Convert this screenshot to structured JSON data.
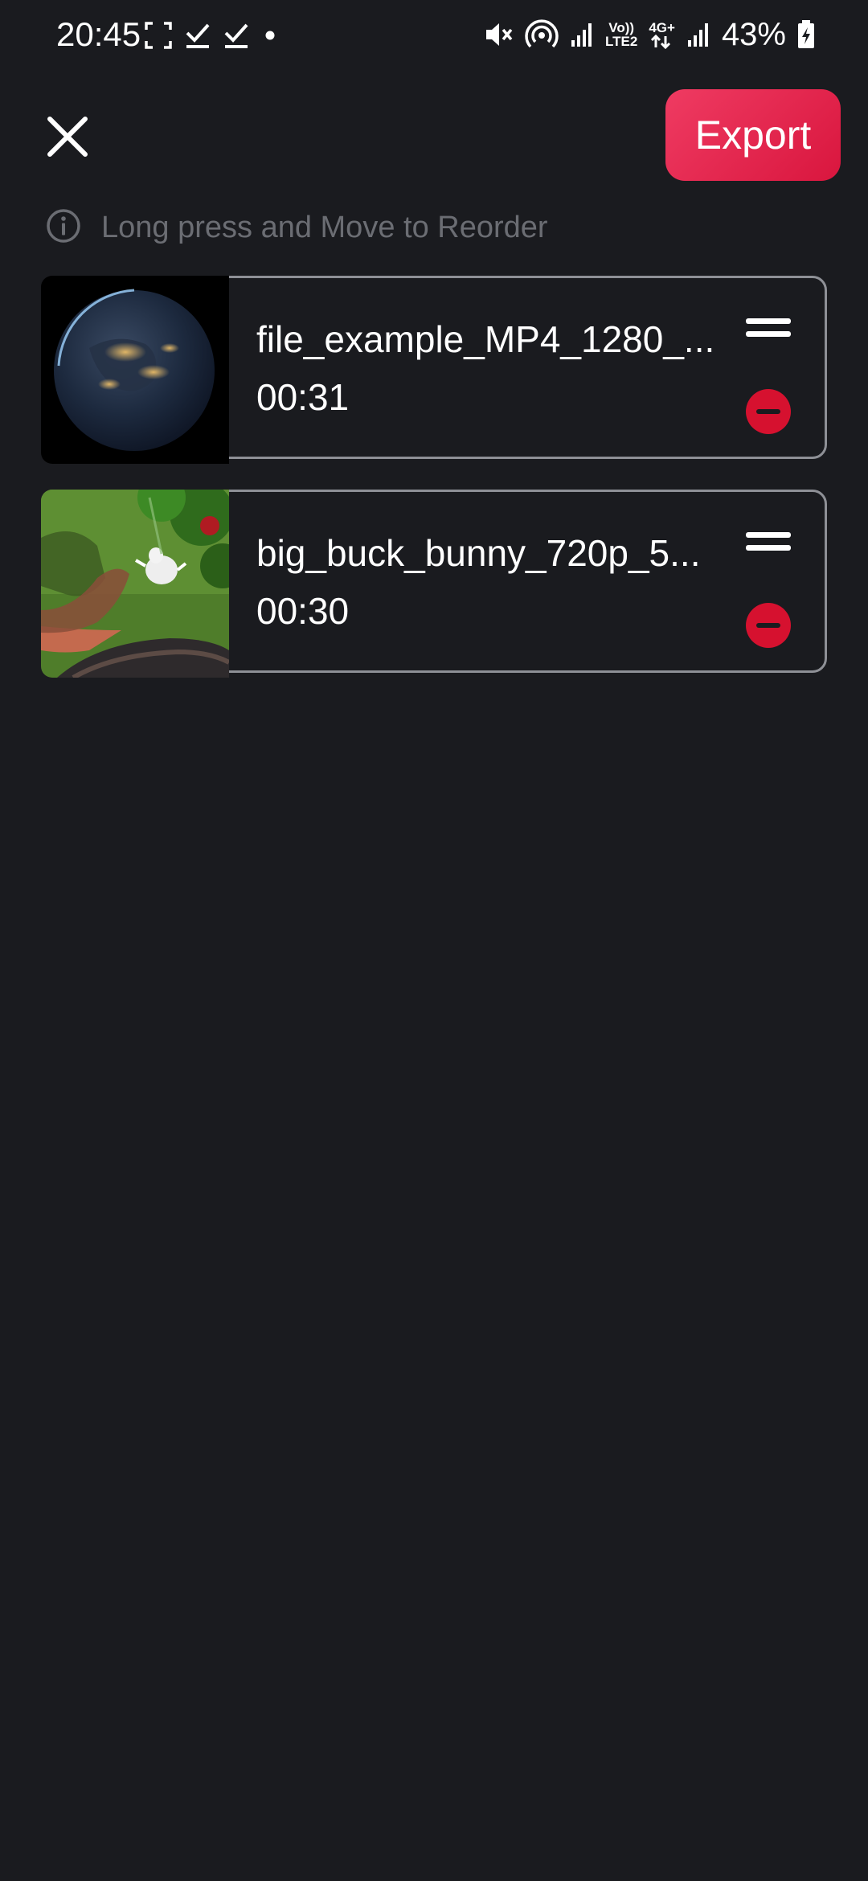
{
  "status_bar": {
    "time": "20:45",
    "network_label_top": "Vo))",
    "network_label_bottom": "LTE2",
    "network_type": "4G+",
    "battery": "43%",
    "icons": [
      "screenshot-icon",
      "check-icon",
      "check-icon",
      "dot-icon",
      "mute-icon",
      "hotspot-icon",
      "signal-icon",
      "data-arrows-icon",
      "signal-icon",
      "battery-charging-icon"
    ]
  },
  "header": {
    "close_icon": "close-icon",
    "export_label": "Export"
  },
  "hint": {
    "icon": "info-icon",
    "text": "Long press and Move to Reorder"
  },
  "clips": [
    {
      "name": "file_example_MP4_1280_...",
      "duration": "00:31",
      "thumbnail": "earth-at-night"
    },
    {
      "name": "big_buck_bunny_720p_5...",
      "duration": "00:30",
      "thumbnail": "bunny-scene"
    }
  ],
  "colors": {
    "background": "#1a1b1f",
    "accent": "#e8254f",
    "remove": "#d6112f",
    "card_border": "#8e9096",
    "hint_text": "#6b6d73"
  }
}
